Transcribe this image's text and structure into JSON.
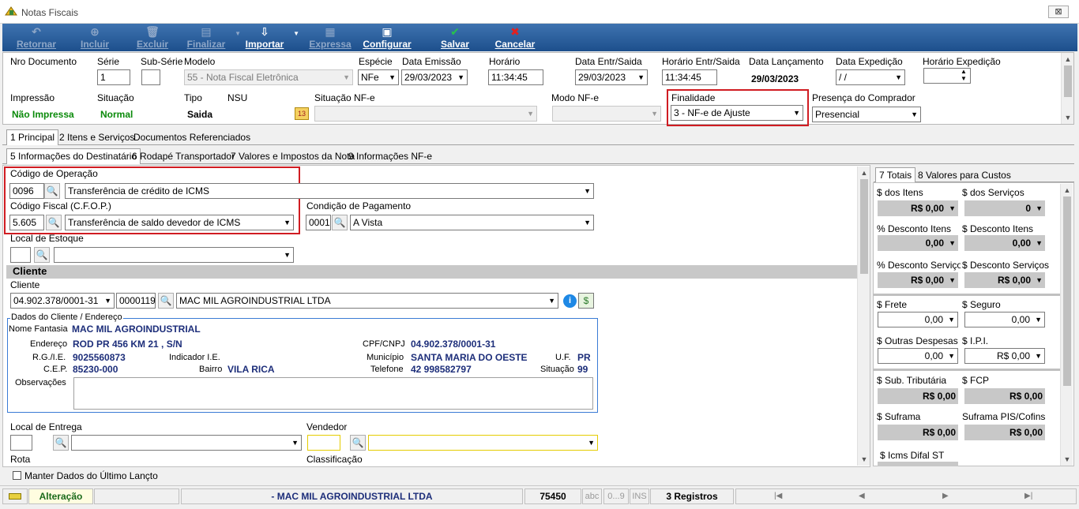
{
  "window": {
    "title": "Notas Fiscais",
    "close_label": "⊠"
  },
  "toolbar": {
    "retornar": "Retornar",
    "incluir": "Incluir",
    "excluir": "Excluir",
    "finalizar": "Finalizar",
    "importar": "Importar",
    "expressa": "Expressa",
    "configurar": "Configurar",
    "salvar": "Salvar",
    "cancelar": "Cancelar"
  },
  "header": {
    "nro_documento_label": "Nro Documento",
    "serie_label": "Série",
    "serie_value": "1",
    "sub_serie_label": "Sub-Série",
    "sub_serie_value": "",
    "modelo_label": "Modelo",
    "modelo_value": "55 - Nota Fiscal Eletrônica",
    "especie_label": "Espécie",
    "especie_value": "NFe",
    "data_emissao_label": "Data Emissão",
    "data_emissao_value": "29/03/2023",
    "horario_label": "Horário",
    "horario_value": "11:34:45",
    "data_entr_saida_label": "Data Entr/Saida",
    "data_entr_saida_value": "29/03/2023",
    "horario_entr_saida_label": "Horário Entr/Saida",
    "horario_entr_saida_value": "11:34:45",
    "data_lancamento_label": "Data Lançamento",
    "data_lancamento_value": "29/03/2023",
    "data_expedicao_label": "Data Expedição",
    "data_expedicao_value": " / /",
    "horario_expedicao_label": "Horário Expedição",
    "horario_expedicao_value": "",
    "impressao_label": "Impressão",
    "impressao_value": "Não Impressa",
    "situacao_label": "Situação",
    "situacao_value": "Normal",
    "tipo_label": "Tipo",
    "tipo_value": "Saida",
    "nsu_label": "NSU",
    "situacao_nfe_label": "Situação NF-e",
    "situacao_nfe_value": "",
    "modo_nfe_label": "Modo NF-e",
    "modo_nfe_value": "",
    "finalidade_label": "Finalidade",
    "finalidade_value": "3 - NF-e de Ajuste",
    "presenca_label": "Presença do Comprador",
    "presenca_value": "Presencial"
  },
  "main_tabs": [
    "1 Principal",
    "2 Itens e Serviços",
    "Documentos Referenciados"
  ],
  "sub_tabs": [
    "5 Informações do Destinatário",
    "6 Rodapé Transportador",
    "7 Valores e Impostos da Nota",
    "9 Informações NF-e"
  ],
  "form": {
    "codigo_operacao_label": "Código de Operação",
    "codigo_operacao_code": "0096",
    "codigo_operacao_desc": "Transferência de crédito de ICMS",
    "cfop_label": "Código Fiscal (C.F.O.P.)",
    "cfop_code": "5.605",
    "cfop_desc": "Transferência de saldo devedor de ICMS",
    "cond_pagamento_label": "Condição de Pagamento",
    "cond_pagamento_code": "0001",
    "cond_pagamento_desc": "A Vista",
    "local_estoque_label": "Local de Estoque",
    "cliente_section": "Cliente",
    "cliente_label": "Cliente",
    "cliente_cnpj": "04.902.378/0001-31",
    "cliente_code": "0000119",
    "cliente_name": "MAC MIL AGROINDUSTRIAL  LTDA",
    "local_entrega_label": "Local de Entrega",
    "vendedor_label": "Vendedor",
    "rota_label": "Rota",
    "classificacao_label": "Classificação",
    "manter_dados_label": "Manter Dados do Último Lançto"
  },
  "dados_cliente": {
    "title": "Dados do Cliente / Endereço",
    "nome_fantasia_label": "Nome Fantasia",
    "nome_fantasia": "MAC MIL AGROINDUSTRIAL",
    "endereco_label": "Endereço",
    "endereco": "ROD PR 456 KM 21 , S/N",
    "cpf_cnpj_label": "CPF/CNPJ",
    "cpf_cnpj": "04.902.378/0001-31",
    "rg_ie_label": "R.G./I.E.",
    "rg_ie": "9025560873",
    "indicador_ie_label": "Indicador I.E.",
    "municipio_label": "Município",
    "municipio": "SANTA MARIA DO OESTE",
    "uf_label": "U.F.",
    "uf": "PR",
    "cep_label": "C.E.P.",
    "cep": "85230-000",
    "bairro_label": "Bairro",
    "bairro": "VILA RICA",
    "telefone_label": "Telefone",
    "telefone": "42 998582797",
    "situacao_label": "Situação",
    "situacao": "99",
    "observacoes_label": "Observações"
  },
  "totals": {
    "tabs": [
      "7 Totais",
      "8 Valores para Custos"
    ],
    "dos_itens_label": "$ dos Itens",
    "dos_itens": "R$ 0,00",
    "dos_servicos_label": "$ dos Serviços",
    "dos_servicos": "0",
    "pct_desc_itens_label": "% Desconto Itens",
    "pct_desc_itens": "0,00",
    "desc_itens_label": "$ Desconto Itens",
    "desc_itens": "0,00",
    "pct_desc_servicos_label": "% Desconto Serviços",
    "pct_desc_servicos": "R$ 0,00",
    "desc_servicos_label": "$ Desconto Serviços",
    "desc_servicos": "R$ 0,00",
    "frete_label": "$ Frete",
    "frete": "0,00",
    "seguro_label": "$ Seguro",
    "seguro": "0,00",
    "outras_despesas_label": "$ Outras Despesas",
    "outras_despesas": "0,00",
    "ipi_label": "$ I.P.I.",
    "ipi": "R$ 0,00",
    "sub_tributaria_label": "$ Sub. Tributária",
    "sub_tributaria": "R$ 0,00",
    "fcp_label": "$ FCP",
    "fcp": "R$ 0,00",
    "suframa_label": "$ Suframa",
    "suframa": "R$ 0,00",
    "suframa_pis_label": "Suframa PIS/Cofins",
    "suframa_pis": "R$ 0,00",
    "icms_difal_label": "$ Icms Difal ST"
  },
  "status": {
    "mode": "Alteração",
    "client": "- MAC MIL AGROINDUSTRIAL  LTDA",
    "number": "75450",
    "abc": "abc",
    "nums": "0...9",
    "ins": "INS",
    "registros": "3 Registros"
  }
}
